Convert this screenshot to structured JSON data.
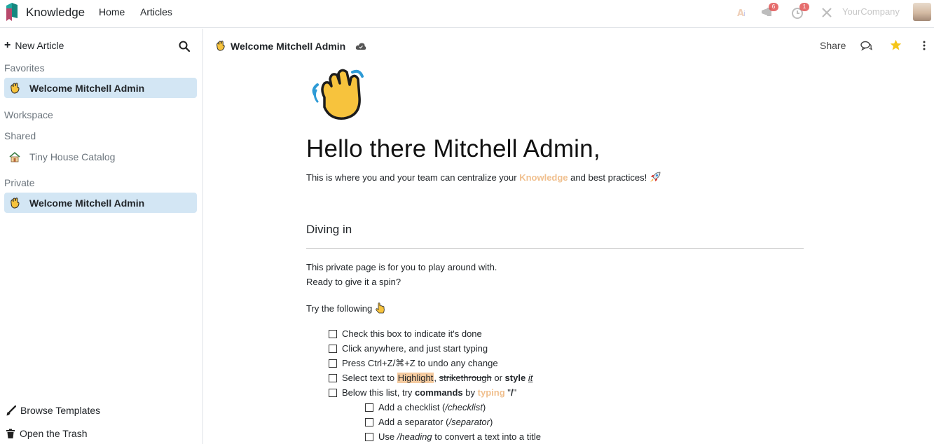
{
  "navbar": {
    "app_name": "Knowledge",
    "links": [
      "Home",
      "Articles"
    ],
    "company": "YourCompany",
    "badges": [
      "6",
      "1"
    ]
  },
  "sidebar": {
    "new_article": "New Article",
    "favorites_label": "Favorites",
    "favorites": [
      {
        "label": "Welcome Mitchell Admin",
        "icon": "waving-hand-emoji"
      }
    ],
    "workspace_label": "Workspace",
    "shared_label": "Shared",
    "shared": [
      {
        "label": "Tiny House Catalog",
        "icon": "house-emoji"
      }
    ],
    "private_label": "Private",
    "private": [
      {
        "label": "Welcome Mitchell Admin",
        "icon": "waving-hand-emoji"
      }
    ],
    "browse_templates": "Browse Templates",
    "open_trash": "Open the Trash"
  },
  "header": {
    "article_name": "Welcome Mitchell Admin",
    "share": "Share"
  },
  "article": {
    "title": "Hello there Mitchell Admin,",
    "intro_before": "This is where you and your team can centralize your ",
    "intro_keyword": "Knowledge",
    "intro_after": " and best practices! ",
    "heading": "Diving in",
    "para1": "This private page is for you to play around with.",
    "para2": "Ready to give it a spin?",
    "try_label": "Try the following ",
    "checklist": {
      "item1": "Check this box to indicate it's done",
      "item2": "Click anywhere, and just start typing",
      "item3": "Press Ctrl+Z/⌘+Z to undo any change",
      "item4_a": "Select text to ",
      "item4_highlight": "Highlight",
      "item4_b": ", ",
      "item4_strike": "strikethrough",
      "item4_c": " or ",
      "item4_style": "style",
      "item4_d": " ",
      "item4_it": "it",
      "item5_a": "Below this list, try ",
      "item5_commands": "commands",
      "item5_b": " by ",
      "item5_typing": "typing",
      "item5_c": " \"",
      "item5_slash": "/",
      "item5_d": "\"",
      "sub1_a": "Add a checklist (",
      "sub1_cmd": "/checklist",
      "sub1_b": ")",
      "sub2_a": "Add a separator (",
      "sub2_cmd": "/separator",
      "sub2_b": ")",
      "sub3_a": "Use ",
      "sub3_cmd": "/heading",
      "sub3_b": " to convert a text into a title"
    }
  },
  "colors": {
    "accent_active": "#d3e6f4",
    "keyword": "#f0c08f",
    "highlight": "#f5cba0",
    "star": "#f5c518"
  }
}
